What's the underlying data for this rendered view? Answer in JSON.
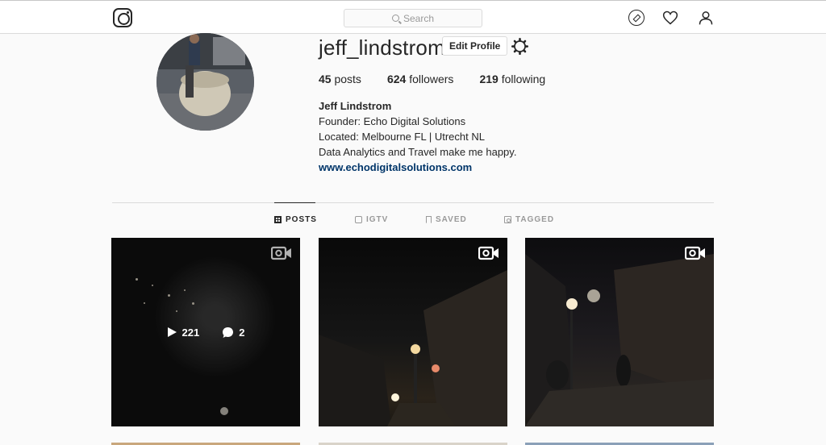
{
  "topbar": {
    "logo_icon": "instagram-logo",
    "search_placeholder": "Search",
    "nav_icons": [
      "compass-icon",
      "heart-icon",
      "person-icon"
    ]
  },
  "profile": {
    "username": "jeff_lindstrom",
    "edit_label": "Edit Profile",
    "settings_icon": "gear-icon",
    "stats": {
      "posts_count": "45",
      "posts_label": "posts",
      "followers_count": "624",
      "followers_label": "followers",
      "following_count": "219",
      "following_label": "following"
    },
    "bio": {
      "full_name": "Jeff Lindstrom",
      "line1": "Founder: Echo Digital Solutions",
      "line2": "Located: Melbourne FL | Utrecht NL",
      "line3": "Data Analytics and Travel make me happy.",
      "website": "www.echodigitalsolutions.com"
    }
  },
  "tabs": [
    {
      "label": "POSTS",
      "active": true
    },
    {
      "label": "IGTV",
      "active": false
    },
    {
      "label": "SAVED",
      "active": false
    },
    {
      "label": "TAGGED",
      "active": false
    }
  ],
  "posts": [
    {
      "type": "video",
      "hover": true,
      "plays": "221",
      "comments": "2"
    },
    {
      "type": "video",
      "hover": false
    },
    {
      "type": "video",
      "hover": false
    }
  ],
  "colors": {
    "link": "#003569",
    "border": "#dbdbdb",
    "text": "#262626",
    "muted": "#999999"
  }
}
